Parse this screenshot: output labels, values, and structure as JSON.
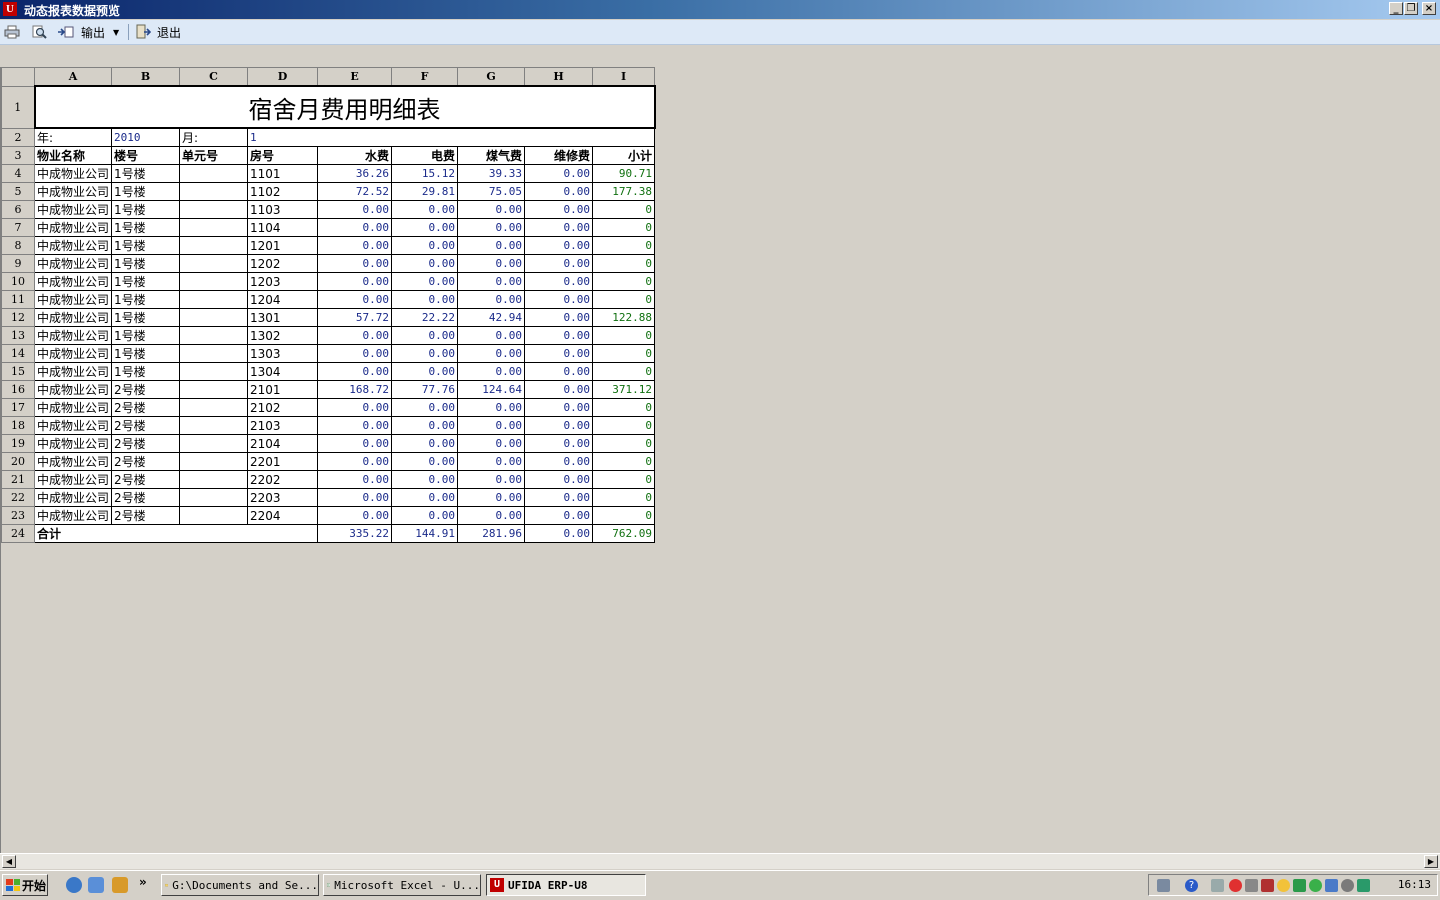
{
  "window": {
    "title": "动态报表数据预览",
    "app_icon": "U8"
  },
  "toolbar": {
    "export_label": "输出",
    "exit_label": "退出"
  },
  "columns": [
    "A",
    "B",
    "C",
    "D",
    "E",
    "F",
    "G",
    "H",
    "I"
  ],
  "report": {
    "title": "宿舍月费用明细表",
    "year_label": "年:",
    "year_value": "2010",
    "month_label": "月:",
    "month_value": "1",
    "headers": [
      "物业名称",
      "楼号",
      "单元号",
      "房号",
      "水费",
      "电费",
      "煤气费",
      "维修费",
      "小计"
    ],
    "rows": [
      [
        "中成物业公司",
        "1号楼",
        "",
        "1101",
        "36.26",
        "15.12",
        "39.33",
        "0.00",
        "90.71"
      ],
      [
        "中成物业公司",
        "1号楼",
        "",
        "1102",
        "72.52",
        "29.81",
        "75.05",
        "0.00",
        "177.38"
      ],
      [
        "中成物业公司",
        "1号楼",
        "",
        "1103",
        "0.00",
        "0.00",
        "0.00",
        "0.00",
        "0"
      ],
      [
        "中成物业公司",
        "1号楼",
        "",
        "1104",
        "0.00",
        "0.00",
        "0.00",
        "0.00",
        "0"
      ],
      [
        "中成物业公司",
        "1号楼",
        "",
        "1201",
        "0.00",
        "0.00",
        "0.00",
        "0.00",
        "0"
      ],
      [
        "中成物业公司",
        "1号楼",
        "",
        "1202",
        "0.00",
        "0.00",
        "0.00",
        "0.00",
        "0"
      ],
      [
        "中成物业公司",
        "1号楼",
        "",
        "1203",
        "0.00",
        "0.00",
        "0.00",
        "0.00",
        "0"
      ],
      [
        "中成物业公司",
        "1号楼",
        "",
        "1204",
        "0.00",
        "0.00",
        "0.00",
        "0.00",
        "0"
      ],
      [
        "中成物业公司",
        "1号楼",
        "",
        "1301",
        "57.72",
        "22.22",
        "42.94",
        "0.00",
        "122.88"
      ],
      [
        "中成物业公司",
        "1号楼",
        "",
        "1302",
        "0.00",
        "0.00",
        "0.00",
        "0.00",
        "0"
      ],
      [
        "中成物业公司",
        "1号楼",
        "",
        "1303",
        "0.00",
        "0.00",
        "0.00",
        "0.00",
        "0"
      ],
      [
        "中成物业公司",
        "1号楼",
        "",
        "1304",
        "0.00",
        "0.00",
        "0.00",
        "0.00",
        "0"
      ],
      [
        "中成物业公司",
        "2号楼",
        "",
        "2101",
        "168.72",
        "77.76",
        "124.64",
        "0.00",
        "371.12"
      ],
      [
        "中成物业公司",
        "2号楼",
        "",
        "2102",
        "0.00",
        "0.00",
        "0.00",
        "0.00",
        "0"
      ],
      [
        "中成物业公司",
        "2号楼",
        "",
        "2103",
        "0.00",
        "0.00",
        "0.00",
        "0.00",
        "0"
      ],
      [
        "中成物业公司",
        "2号楼",
        "",
        "2104",
        "0.00",
        "0.00",
        "0.00",
        "0.00",
        "0"
      ],
      [
        "中成物业公司",
        "2号楼",
        "",
        "2201",
        "0.00",
        "0.00",
        "0.00",
        "0.00",
        "0"
      ],
      [
        "中成物业公司",
        "2号楼",
        "",
        "2202",
        "0.00",
        "0.00",
        "0.00",
        "0.00",
        "0"
      ],
      [
        "中成物业公司",
        "2号楼",
        "",
        "2203",
        "0.00",
        "0.00",
        "0.00",
        "0.00",
        "0"
      ],
      [
        "中成物业公司",
        "2号楼",
        "",
        "2204",
        "0.00",
        "0.00",
        "0.00",
        "0.00",
        "0"
      ]
    ],
    "total_label": "合计",
    "totals": [
      "335.22",
      "144.91",
      "281.96",
      "0.00",
      "762.09"
    ]
  },
  "taskbar": {
    "start_label": "开始",
    "quick_more": "»",
    "tasks": [
      "G:\\Documents and Se...",
      "Microsoft Excel - U...",
      "UFIDA ERP-U8"
    ],
    "clock": "16:13"
  },
  "colors": {
    "title_bar": "#0a246a",
    "toolbar": "#dde9f7",
    "number_text": "#1a2a8a",
    "subtotal_text": "#107010"
  }
}
